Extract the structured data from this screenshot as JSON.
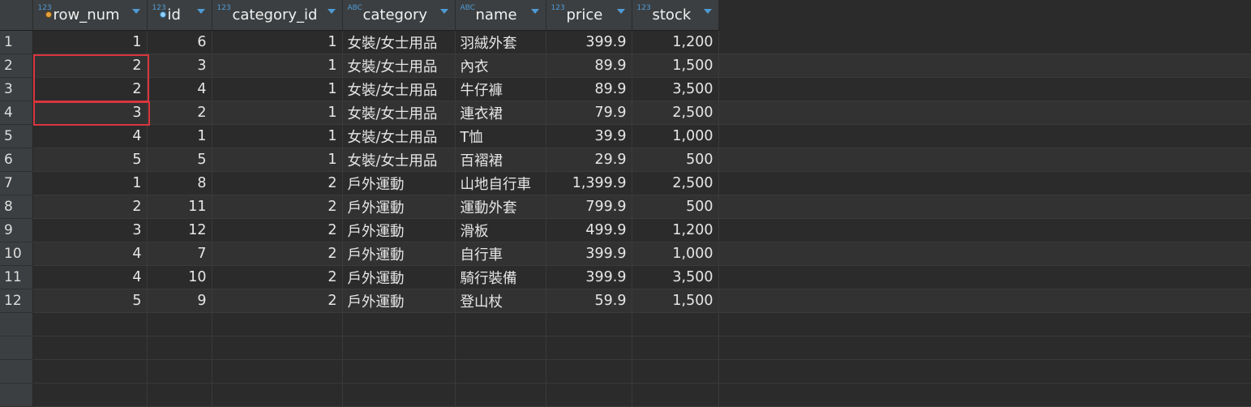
{
  "columns": [
    {
      "label": "row_num",
      "type": "123",
      "key": "orange"
    },
    {
      "label": "id",
      "type": "123",
      "key": "blue"
    },
    {
      "label": "category_id",
      "type": "123",
      "key": ""
    },
    {
      "label": "category",
      "type": "ABC",
      "key": ""
    },
    {
      "label": "name",
      "type": "ABC",
      "key": ""
    },
    {
      "label": "price",
      "type": "123",
      "key": ""
    },
    {
      "label": "stock",
      "type": "123",
      "key": ""
    }
  ],
  "rows": [
    {
      "n": "1",
      "row_num": "1",
      "id": "6",
      "category_id": "1",
      "category": "女裝/女士用品",
      "name": "羽絨外套",
      "price": "399.9",
      "stock": "1,200"
    },
    {
      "n": "2",
      "row_num": "2",
      "id": "3",
      "category_id": "1",
      "category": "女裝/女士用品",
      "name": "內衣",
      "price": "89.9",
      "stock": "1,500"
    },
    {
      "n": "3",
      "row_num": "2",
      "id": "4",
      "category_id": "1",
      "category": "女裝/女士用品",
      "name": "牛仔褲",
      "price": "89.9",
      "stock": "3,500"
    },
    {
      "n": "4",
      "row_num": "3",
      "id": "2",
      "category_id": "1",
      "category": "女裝/女士用品",
      "name": "連衣裙",
      "price": "79.9",
      "stock": "2,500"
    },
    {
      "n": "5",
      "row_num": "4",
      "id": "1",
      "category_id": "1",
      "category": "女裝/女士用品",
      "name": "T恤",
      "price": "39.9",
      "stock": "1,000"
    },
    {
      "n": "6",
      "row_num": "5",
      "id": "5",
      "category_id": "1",
      "category": "女裝/女士用品",
      "name": "百褶裙",
      "price": "29.9",
      "stock": "500"
    },
    {
      "n": "7",
      "row_num": "1",
      "id": "8",
      "category_id": "2",
      "category": "戶外運動",
      "name": "山地自行車",
      "price": "1,399.9",
      "stock": "2,500"
    },
    {
      "n": "8",
      "row_num": "2",
      "id": "11",
      "category_id": "2",
      "category": "戶外運動",
      "name": "運動外套",
      "price": "799.9",
      "stock": "500"
    },
    {
      "n": "9",
      "row_num": "3",
      "id": "12",
      "category_id": "2",
      "category": "戶外運動",
      "name": "滑板",
      "price": "499.9",
      "stock": "1,200"
    },
    {
      "n": "10",
      "row_num": "4",
      "id": "7",
      "category_id": "2",
      "category": "戶外運動",
      "name": "自行車",
      "price": "399.9",
      "stock": "1,000"
    },
    {
      "n": "11",
      "row_num": "4",
      "id": "10",
      "category_id": "2",
      "category": "戶外運動",
      "name": "騎行裝備",
      "price": "399.9",
      "stock": "3,500"
    },
    {
      "n": "12",
      "row_num": "5",
      "id": "9",
      "category_id": "2",
      "category": "戶外運動",
      "name": "登山杖",
      "price": "59.9",
      "stock": "1,500"
    }
  ],
  "colors": {
    "highlight": "#d9363e",
    "type_tag": "#4e9bd6",
    "key_orange": "#e9a23b",
    "key_blue": "#8fd0ff"
  }
}
